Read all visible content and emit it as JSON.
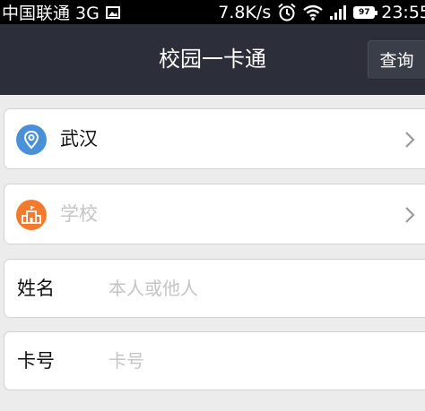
{
  "status_bar": {
    "carrier": "中国联通 3G",
    "network_speed": "7.8K/s",
    "battery_level": "97",
    "time": "23:55",
    "icons": [
      "image-icon",
      "alarm-icon",
      "wifi-icon",
      "signal-icon",
      "battery-icon"
    ]
  },
  "header": {
    "title": "校园一卡通",
    "query_button": "查询"
  },
  "form": {
    "city": {
      "value": "武汉",
      "icon": "location-pin-icon",
      "icon_color": "#4a90d9"
    },
    "school": {
      "placeholder": "学校",
      "icon": "school-building-icon",
      "icon_color": "#f47a2e"
    },
    "name": {
      "label": "姓名",
      "placeholder": "本人或他人"
    },
    "card_number": {
      "label": "卡号",
      "placeholder": "卡号"
    }
  },
  "colors": {
    "header_bg": "#2c2f39",
    "page_bg": "#ececec",
    "placeholder": "#c4c4c4"
  }
}
